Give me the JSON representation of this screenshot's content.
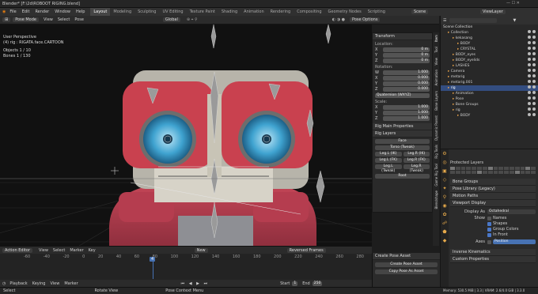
{
  "app": {
    "title": "Blender* [F:\\2d\\ROBOOT RIGING.blend]",
    "colors": {
      "accent": "#4772b3",
      "header_bg": "#303030",
      "panel_bg": "#2a2a2a"
    }
  },
  "menu": [
    "File",
    "Edit",
    "Render",
    "Window",
    "Help"
  ],
  "workspaces": [
    "Layout",
    "Modeling",
    "Sculpting",
    "UV Editing",
    "Texture Paint",
    "Shading",
    "Animation",
    "Rendering",
    "Compositing",
    "Geometry Nodes",
    "Scripting"
  ],
  "topright": {
    "scene_label": "Scene",
    "viewlayer_label": "ViewLayer"
  },
  "viewport_header": {
    "mode": "Pose Mode",
    "menus": [
      "View",
      "Select",
      "Pose"
    ],
    "orientation": "Global",
    "pose_options": "Pose Options"
  },
  "overlay": {
    "view_name": "User Perspective",
    "object_name": "(4) rig : RIGATA.face.CARTOON",
    "objects": "Objects   1 / 10",
    "bones": "Bones     1 / 130"
  },
  "transform": {
    "title": "Transform",
    "location_label": "Location:",
    "location": [
      {
        "axis": "X",
        "value": "0 m"
      },
      {
        "axis": "Y",
        "value": "0 m"
      },
      {
        "axis": "Z",
        "value": "0 m"
      }
    ],
    "rotation_label": "Rotation:",
    "rotation": [
      {
        "axis": "W",
        "value": "1.000"
      },
      {
        "axis": "X",
        "value": "0.000"
      },
      {
        "axis": "Y",
        "value": "0.000"
      },
      {
        "axis": "Z",
        "value": "0.000"
      }
    ],
    "rotation_mode": "Quaternion (WXYZ)",
    "scale_label": "Scale:",
    "scale": [
      {
        "axis": "X",
        "value": "1.000"
      },
      {
        "axis": "Y",
        "value": "1.000"
      },
      {
        "axis": "Z",
        "value": "1.000"
      }
    ]
  },
  "rig_main": {
    "title": "Rig Main Properties"
  },
  "rig_layers": {
    "title": "Rig Layers",
    "face": "Face",
    "torso": "Torso (Tweak)",
    "leg_l_ik": "Leg.L (IK)",
    "leg_r_ik": "Leg.R (IK)",
    "leg_l_fk": "Leg.L (FK)",
    "leg_r_fk": "Leg.R (FK)",
    "leg_l_tweak": "Leg.L (Tweak)",
    "leg_r_tweak": "Leg.R (Tweak)",
    "root": "Root"
  },
  "side_tabs": [
    "Item",
    "Tool",
    "View",
    "Animation",
    "Bone Layers",
    "Dynamic Parent",
    "Rig Tools",
    "Game Rig Tool",
    "Blendshape"
  ],
  "outliner": {
    "title": "Scene Collection",
    "rows": [
      {
        "label": "Collection",
        "indent": 1
      },
      {
        "label": "kekasang",
        "indent": 2
      },
      {
        "label": "BODY",
        "indent": 3
      },
      {
        "label": "CRYSTAL",
        "indent": 3
      },
      {
        "label": "BODY_eyes",
        "indent": 2
      },
      {
        "label": "BODY_eyelids",
        "indent": 2
      },
      {
        "label": "LASHES",
        "indent": 2
      },
      {
        "label": "Camera",
        "indent": 1
      },
      {
        "label": "metarig",
        "indent": 1
      },
      {
        "label": "metarig.001",
        "indent": 1
      },
      {
        "label": "rig",
        "indent": 1,
        "selected": true
      },
      {
        "label": "Animation",
        "indent": 2
      },
      {
        "label": "Pose",
        "indent": 2
      },
      {
        "label": "Bone Groups",
        "indent": 2
      },
      {
        "label": "rig",
        "indent": 2
      },
      {
        "label": "BODY",
        "indent": 3
      }
    ]
  },
  "properties": {
    "protected_layers": "Protected Layers",
    "bone_groups": "Bone Groups",
    "pose_library": "Pose Library (Legacy)",
    "motion_paths": "Motion Paths",
    "viewport_display": "Viewport Display",
    "display_as_label": "Display As",
    "display_as": "Octahedral",
    "show_label": "Show",
    "show_items": [
      {
        "label": "Names",
        "checked": false
      },
      {
        "label": "Shapes",
        "checked": true
      },
      {
        "label": "Group Colors",
        "checked": true
      },
      {
        "label": "In Front",
        "checked": true
      }
    ],
    "axes_label": "Axes",
    "axes_position": "Position",
    "inverse_kinematics": "Inverse Kinematics",
    "custom_properties": "Custom Properties"
  },
  "timeline": {
    "editor": "Action Editor",
    "menus": [
      "View",
      "Select",
      "Marker",
      "Key"
    ],
    "new_button": "New",
    "frames": [
      "-60",
      "-40",
      "-20",
      "0",
      "20",
      "40",
      "60",
      "80",
      "100",
      "120",
      "140",
      "160",
      "180",
      "200",
      "220",
      "240",
      "260",
      "280"
    ],
    "current_frame": "4",
    "playback": "Playback",
    "keying": "Keying",
    "view": "View",
    "marker": "Marker",
    "start": "Start",
    "start_value": "1",
    "end": "End",
    "end_value": "250",
    "reversed_frames": "Reversed Frames"
  },
  "asset_panel": {
    "title": "Create Pose Asset",
    "create": "Create Pose Asset",
    "copy": "Copy Pose As Asset"
  },
  "status": {
    "left": "Select",
    "mid": "Rotate View",
    "right": "Pose Context Menu",
    "memory": "Memory: 530.5 MiB | 3.3 | VRAM: 2.6/4.0 GiB | 3.3.0"
  }
}
